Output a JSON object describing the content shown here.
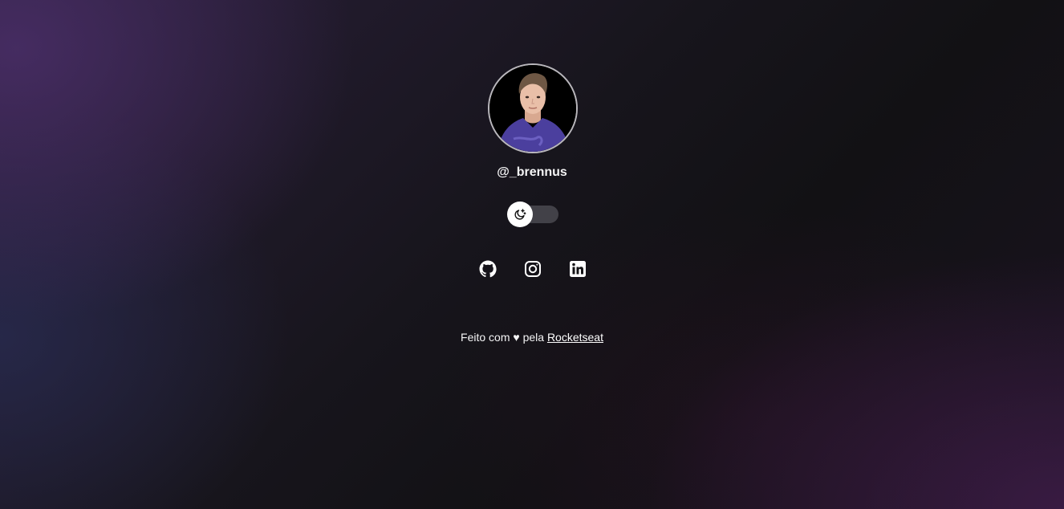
{
  "profile": {
    "handle": "@_brennus",
    "avatar_alt": "profile photo"
  },
  "theme_switch": {
    "icon": "moon-stars-icon",
    "state": "dark"
  },
  "socials": [
    {
      "name": "github",
      "icon": "github-icon"
    },
    {
      "name": "instagram",
      "icon": "instagram-icon"
    },
    {
      "name": "linkedin",
      "icon": "linkedin-icon"
    }
  ],
  "footer": {
    "prefix": "Feito com",
    "heart": "♥",
    "middle": "pela",
    "link_text": "Rocketseat"
  },
  "colors": {
    "text": "#ffffff",
    "switch_track": "#4a4950",
    "accent_purple": "#4a2e68"
  }
}
